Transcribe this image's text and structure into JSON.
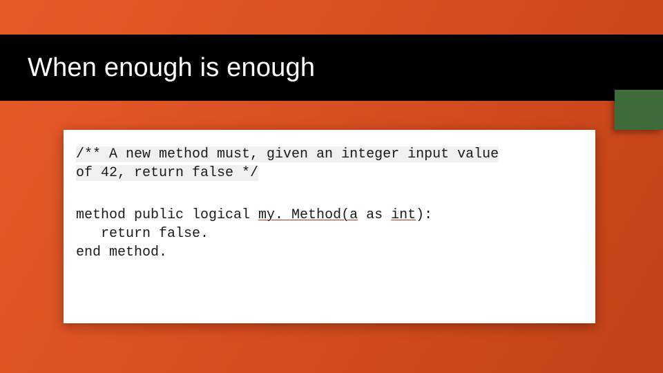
{
  "slide": {
    "title": "When enough is enough",
    "comment_line1": "/** A new method must, given an integer input value",
    "comment_line2": "of 42, return false */",
    "code": {
      "l1_a": "method public logical ",
      "l1_b": "my. Method(a",
      "l1_c": " as ",
      "l1_d": "int",
      "l1_e": "):",
      "l2": "   return false.",
      "l3": "end method."
    }
  }
}
